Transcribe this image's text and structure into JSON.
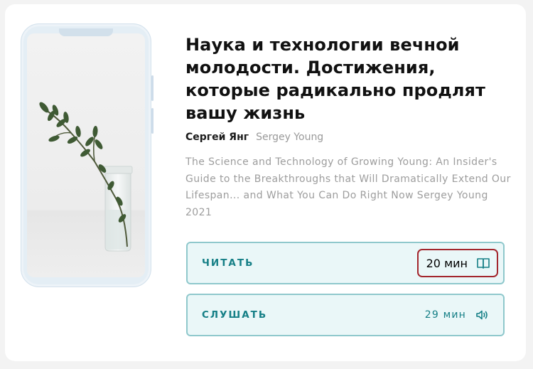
{
  "book": {
    "title": "Наука и технологии вечной молодости. Достижения, которые радикально продлят вашу жизнь",
    "author_ru": "Сергей Янг",
    "author_en": "Sergey Young",
    "description": "The Science and Technology of Growing Young: An Insider's Guide to the Breakthroughs that Will Dramatically Extend Our Lifespan... and What You Can Do Right Now Sergey Young 2021"
  },
  "actions": {
    "read": {
      "label": "ЧИТАТЬ",
      "time": "20 мин",
      "icon": "book-icon"
    },
    "listen": {
      "label": "СЛУШАТЬ",
      "time": "29 мин",
      "icon": "speaker-icon"
    }
  },
  "colors": {
    "accent": "#157f86",
    "button_bg": "#eaf7f8",
    "button_border": "#8fc8cc",
    "highlight": "#a3262d"
  }
}
